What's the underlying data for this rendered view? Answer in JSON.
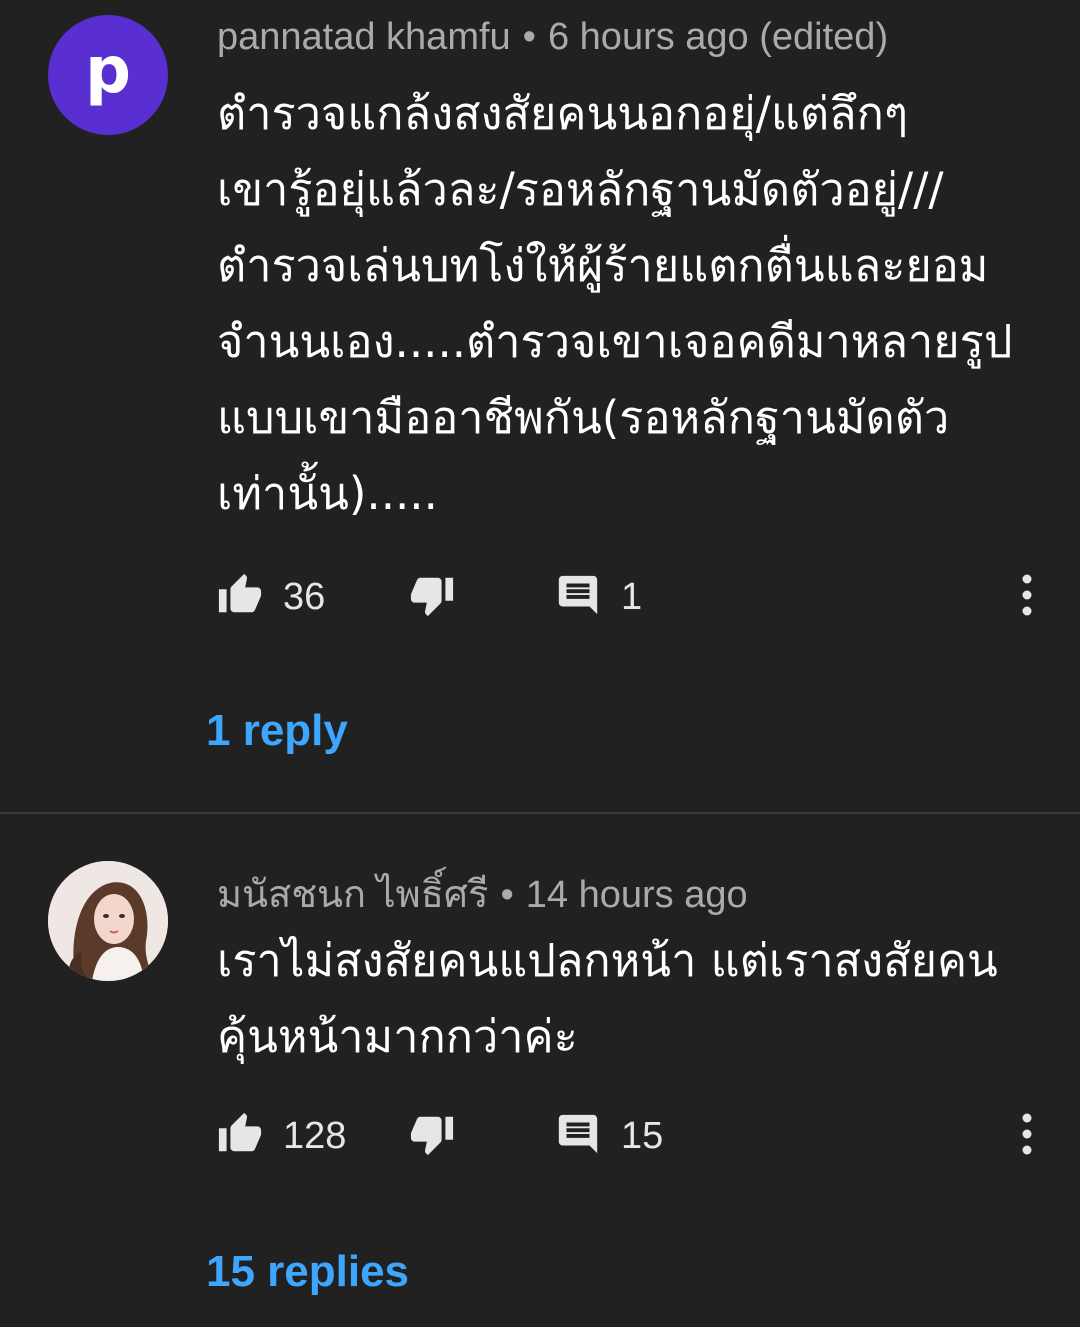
{
  "comments": [
    {
      "avatar_letter": "p",
      "avatar_color": "#5a2fd1",
      "author": "pannatad khamfu",
      "time": "6 hours ago (edited)",
      "text": "ตำรวจแกล้งสงสัยคนนอกอยุ่/แต่ลึกๆ\nเขารู้อยุ่แล้วละ/รอหลักฐานมัดตัวอยู่///\nตำรวจเล่นบทโง่ให้ผู้ร้ายแตกตื่นและยอม\nจำนนเอง.....ตำรวจเขาเจอคดีมาหลายรูป\nแบบเขามืออาชีพกัน(รอหลักฐานมัดตัว\nเท่านั้น).....",
      "likes": "36",
      "reply_count": "1",
      "replies_link": "1 reply"
    },
    {
      "avatar_icon": "profile-photo",
      "author": "มนัสชนก ไพธิ์ศรี",
      "time": "14 hours ago",
      "text": "เราไม่สงสัยคนแปลกหน้า แต่เราสงสัยคน\nคุ้นหน้ามากกว่าค่ะ",
      "likes": "128",
      "reply_count": "15",
      "replies_link": "15 replies"
    }
  ],
  "colors": {
    "background": "#212121",
    "link": "#3ea6ff",
    "meta": "#aaaaaa",
    "icon": "#e6e6e6"
  },
  "separator": "•"
}
